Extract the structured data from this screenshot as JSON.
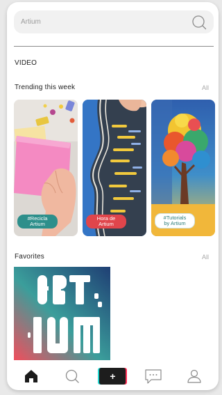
{
  "search": {
    "placeholder": "Artium",
    "icon": "search-icon"
  },
  "section_video": "VIDEO",
  "trending": {
    "title": "Trending this week",
    "all_label": "All",
    "cards": [
      {
        "badge": "#Recicla\nArtium",
        "badge_color": "#2d8f8b"
      },
      {
        "badge": "Hora de\nArtium",
        "badge_color": "#e0454b"
      },
      {
        "badge": "#Tutorials\nby Artium",
        "badge_color": "#ffffff"
      }
    ]
  },
  "favorites": {
    "title": "Favorites",
    "all_label": "All",
    "artwork_text": "ART IUM"
  },
  "nav": {
    "items": [
      "home-icon",
      "search-icon",
      "add-icon",
      "chat-icon",
      "profile-icon"
    ],
    "add_label": "+"
  },
  "colors": {
    "accent_cyan": "#24d6d0",
    "accent_pink": "#ff2d55",
    "text": "#1c1c1c",
    "muted": "#a8a8a8"
  }
}
